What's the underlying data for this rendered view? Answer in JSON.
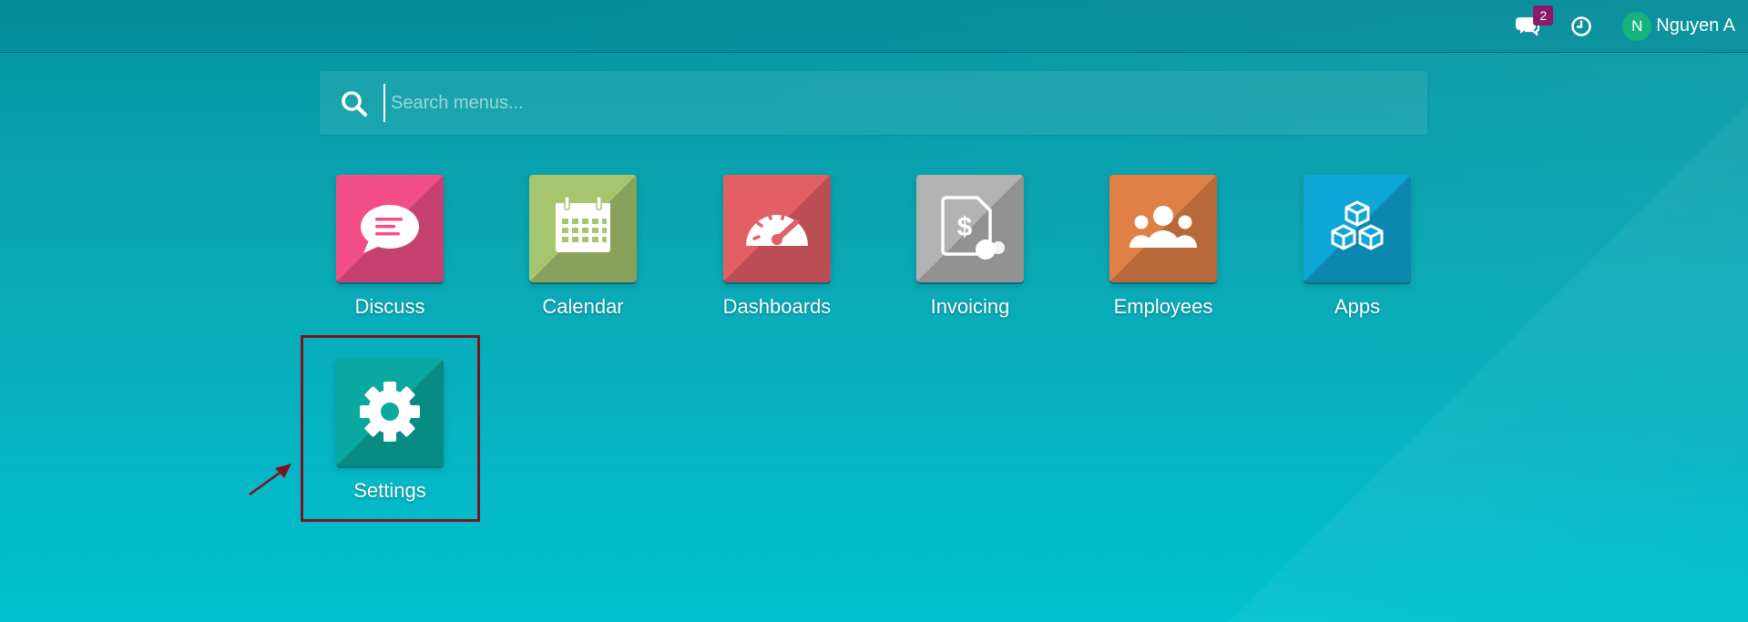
{
  "topbar": {
    "chat_badge": "2",
    "user_initial": "N",
    "user_name": "Nguyen A"
  },
  "search": {
    "placeholder": "Search menus..."
  },
  "apps": [
    {
      "label": "Discuss",
      "icon": "chat-bubble-icon",
      "color": "#f24f88"
    },
    {
      "label": "Calendar",
      "icon": "calendar-icon",
      "color": "#a6c56f"
    },
    {
      "label": "Dashboards",
      "icon": "speedometer-icon",
      "color": "#e35f66"
    },
    {
      "label": "Invoicing",
      "icon": "invoice-icon",
      "color": "#b2b2b2"
    },
    {
      "label": "Employees",
      "icon": "people-icon",
      "color": "#e08047"
    },
    {
      "label": "Apps",
      "icon": "cubes-icon",
      "color": "#0ea6d6"
    },
    {
      "label": "Settings",
      "icon": "gear-icon",
      "color": "#0aa9a0"
    }
  ],
  "annotation": {
    "highlight_color": "#7a1520"
  }
}
